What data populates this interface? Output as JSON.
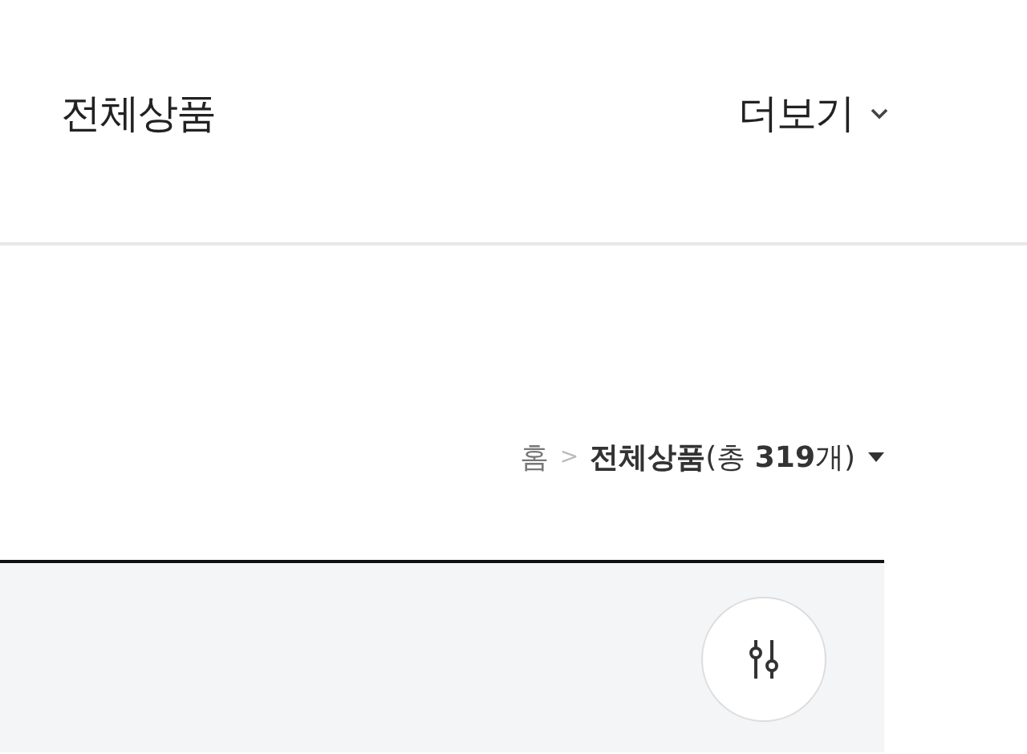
{
  "header": {
    "title": "전체상품",
    "more_label": "더보기"
  },
  "breadcrumb": {
    "home": "홈",
    "separator": ">",
    "current": "**전체상품**(총 **319**개)"
  }
}
